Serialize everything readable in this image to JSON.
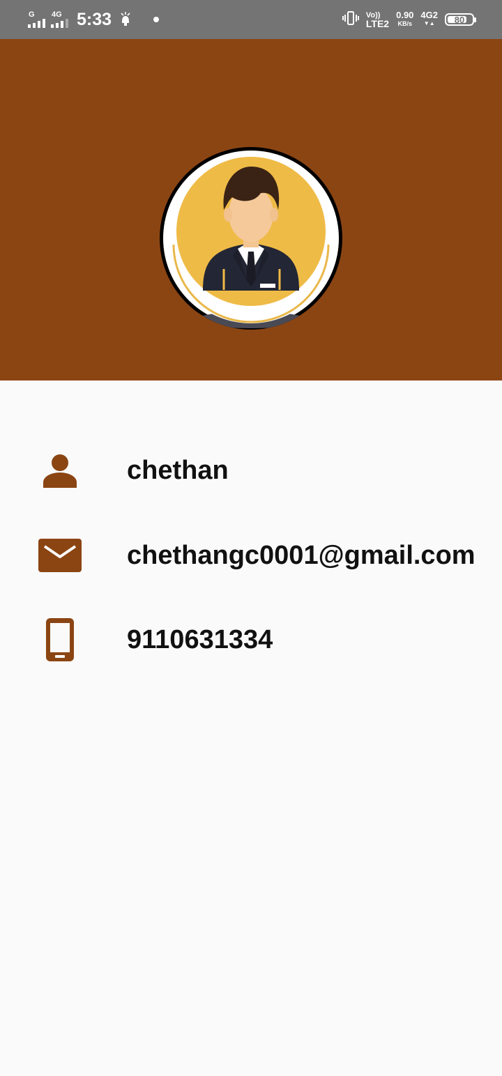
{
  "status_bar": {
    "sim1_label": "G",
    "sim2_label": "4G",
    "time": "5:33",
    "volte_top": "Vo))",
    "volte_bottom": "LTE2",
    "speed_value": "0.90",
    "speed_unit": "KB/s",
    "network_type": "4G2",
    "battery_level": "80",
    "icons": [
      "signal-icon",
      "notification-app-icon",
      "vibrate-icon",
      "battery-icon"
    ]
  },
  "profile": {
    "header_color": "#8B4513",
    "accent_color": "#8B4513",
    "avatar_icon": "avatar-businessman-icon",
    "name": "chethan",
    "email": "chethangc0001@gmail.com",
    "phone": "9110631334",
    "row_icons": [
      "person-icon",
      "mail-icon",
      "phone-icon"
    ]
  }
}
